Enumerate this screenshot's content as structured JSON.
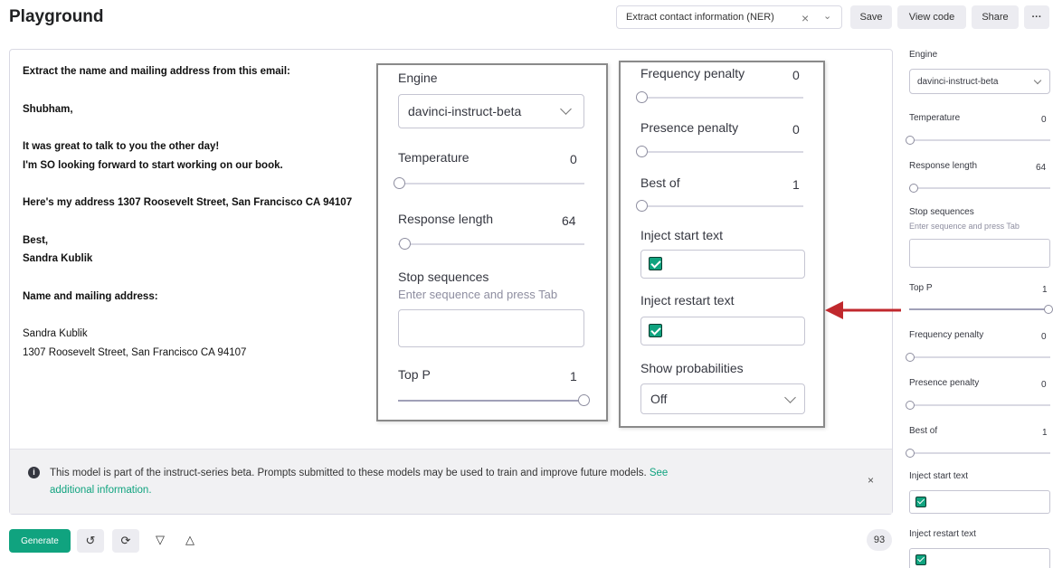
{
  "header": {
    "title": "Playground",
    "preset": "Extract contact information (NER)",
    "save": "Save",
    "view_code": "View code",
    "share": "Share",
    "more": "···"
  },
  "prompt": {
    "instruction": "Extract the name and mailing address from this email:",
    "greeting": "Shubham,",
    "line1": "It was great to talk to you the other day!",
    "line2": "I'm SO looking forward to start working on our book.",
    "line3": "Here's my address 1307 Roosevelt Street, San Francisco CA 94107",
    "signoff": "Best,",
    "signature": "Sandra Kublik",
    "label": "Name and mailing address:",
    "out_name": "Sandra Kublik",
    "out_address": "1307 Roosevelt Street, San Francisco CA 94107"
  },
  "notice": {
    "text": "This model is part of the instruct-series beta. Prompts submitted to these models may be used to train and improve future models.",
    "link_see": "See",
    "link_more": "additional information.",
    "close": "×"
  },
  "bottom": {
    "generate": "Generate",
    "token_count": "93"
  },
  "settings": {
    "engine_label": "Engine",
    "engine_value": "davinci-instruct-beta",
    "temperature_label": "Temperature",
    "temperature_value": "0",
    "temperature_level": 0.0,
    "response_length_label": "Response length",
    "response_length_value": "64",
    "response_length_level": 0.03,
    "stop_label": "Stop sequences",
    "stop_hint": "Enter sequence and press Tab",
    "top_p_label": "Top P",
    "top_p_value": "1",
    "top_p_level": 1.0,
    "frequency_label": "Frequency penalty",
    "frequency_value": "0",
    "presence_label": "Presence penalty",
    "presence_value": "0",
    "best_of_label": "Best of",
    "best_of_value": "1",
    "inject_start_label": "Inject start text",
    "inject_start_checked": true,
    "inject_restart_label": "Inject restart text",
    "inject_restart_checked": true,
    "show_prob_label": "Show probabilities",
    "show_prob_value": "Off"
  },
  "colors": {
    "accent": "#10a37f",
    "arrow": "#c0282d"
  },
  "icons": [
    "info-icon",
    "close-icon",
    "chevron-down-icon",
    "undo-icon",
    "regenerate-icon",
    "thumbs-down-icon",
    "thumbs-up-icon",
    "checkbox-check-icon",
    "arrow-left-icon"
  ]
}
